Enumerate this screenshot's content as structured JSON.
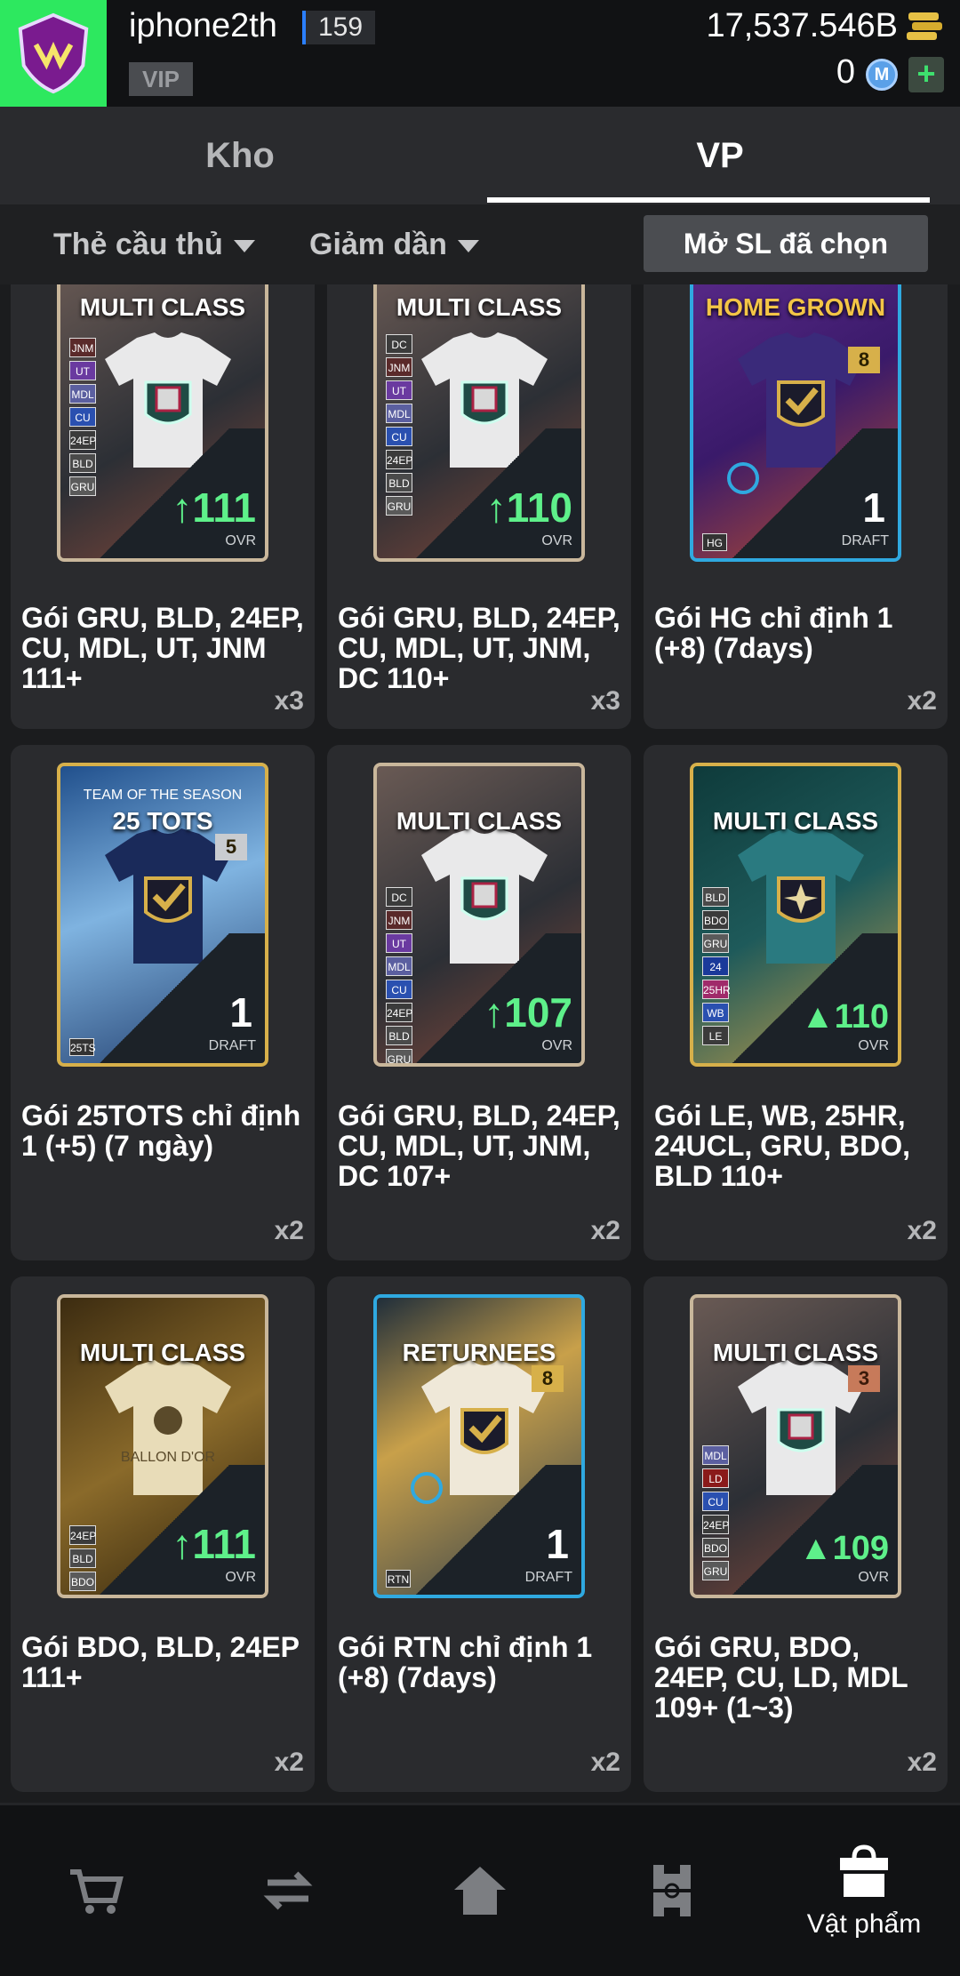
{
  "header": {
    "username": "iphone2th",
    "level": "159",
    "vip": "VIP",
    "coins": "17,537.546B",
    "mcoins": "0",
    "m_symbol": "M",
    "plus": "+"
  },
  "tabs": [
    {
      "label": "Kho"
    },
    {
      "label": "VP"
    }
  ],
  "filters": {
    "type": "Thẻ cầu thủ",
    "sort": "Giảm dần",
    "open_selected": "Mở SL đã chọn"
  },
  "items": [
    {
      "name": "Gói GRU, BLD, 24EP, CU, MDL, UT, JNM 111+",
      "qty": "x3",
      "title": "MULTI CLASS",
      "ovr": "111",
      "ovr_label": "OVR",
      "tags": [
        "JNM",
        "UT",
        "MDL",
        "CU",
        "24EP",
        "BLD",
        "GRU"
      ]
    },
    {
      "name": "Gói GRU, BLD, 24EP, CU, MDL, UT, JNM, DC 110+",
      "qty": "x3",
      "title": "MULTI CLASS",
      "ovr": "110",
      "ovr_label": "OVR",
      "tags": [
        "DC",
        "JNM",
        "UT",
        "MDL",
        "CU",
        "24EP",
        "BLD",
        "GRU"
      ]
    },
    {
      "name": "Gói HG chỉ định 1 (+8) (7days)",
      "qty": "x2",
      "title": "HOME GROWN",
      "draft": "1",
      "draft_label": "DRAFT",
      "plus": "8",
      "small_tag": "HG"
    },
    {
      "name": "Gói 25TOTS chỉ định 1 (+5) (7 ngày)",
      "qty": "x2",
      "title": "25 TOTS",
      "subtitle": "TEAM OF THE SEASON",
      "draft": "1",
      "draft_label": "DRAFT",
      "plus": "5",
      "small_tag": "25TS"
    },
    {
      "name": "Gói GRU, BLD, 24EP, CU, MDL, UT, JNM, DC 107+",
      "qty": "x2",
      "title": "MULTI CLASS",
      "ovr": "107",
      "ovr_label": "OVR",
      "tags": [
        "DC",
        "JNM",
        "UT",
        "MDL",
        "CU",
        "24EP",
        "BLD",
        "GRU"
      ]
    },
    {
      "name": "Gói LE, WB, 25HR, 24UCL, GRU, BDO, BLD 110+",
      "qty": "x2",
      "title": "MULTI CLASS",
      "ovr": "110",
      "ovr_label": "OVR",
      "tags": [
        "BLD",
        "BDO",
        "GRU",
        "24",
        "25HR",
        "WB",
        "LE"
      ]
    },
    {
      "name": "Gói BDO, BLD, 24EP 111+",
      "qty": "x2",
      "title": "MULTI CLASS",
      "ovr": "111",
      "ovr_label": "OVR",
      "tags": [
        "24EP",
        "BLD",
        "BDO"
      ],
      "shirt_text": "BALLON D'OR"
    },
    {
      "name": "Gói RTN chỉ định 1 (+8) (7days)",
      "qty": "x2",
      "title": "RETURNEES",
      "draft": "1",
      "draft_label": "DRAFT",
      "plus": "8",
      "small_tag": "RTN"
    },
    {
      "name": "Gói GRU, BDO, 24EP, CU, LD, MDL 109+ (1~3)",
      "qty": "x2",
      "title": "MULTI CLASS",
      "ovr": "109",
      "ovr_label": "OVR",
      "plus": "3",
      "tags": [
        "MDL",
        "LD",
        "CU",
        "24EP",
        "BDO",
        "GRU"
      ]
    }
  ],
  "nav": [
    {
      "icon": "cart-icon",
      "label": ""
    },
    {
      "icon": "transfer-icon",
      "label": ""
    },
    {
      "icon": "home-icon",
      "label": ""
    },
    {
      "icon": "pitch-icon",
      "label": ""
    },
    {
      "icon": "bag-icon",
      "label": "Vật phẩm"
    }
  ],
  "colors": {
    "accent_green": "#2de85f",
    "ovr_green": "#5ef08a",
    "tab_active": "#ffffff"
  }
}
